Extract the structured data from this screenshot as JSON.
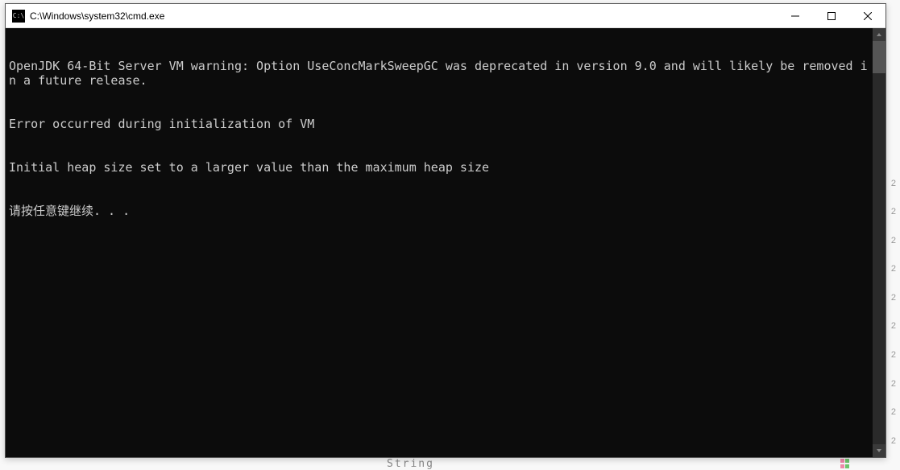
{
  "window": {
    "title": "C:\\Windows\\system32\\cmd.exe",
    "icon_label": "cmd-icon"
  },
  "terminal": {
    "lines": [
      "OpenJDK 64-Bit Server VM warning: Option UseConcMarkSweepGC was deprecated in version 9.0 and will likely be removed in a future release.",
      "Error occurred during initialization of VM",
      "Initial heap size set to a larger value than the maximum heap size",
      "请按任意键继续. . ."
    ]
  },
  "background": {
    "bottom_text": "String",
    "side_numbers": [
      "2",
      "2",
      "2",
      "2",
      "2",
      "2",
      "2",
      "2",
      "2",
      "2"
    ]
  }
}
